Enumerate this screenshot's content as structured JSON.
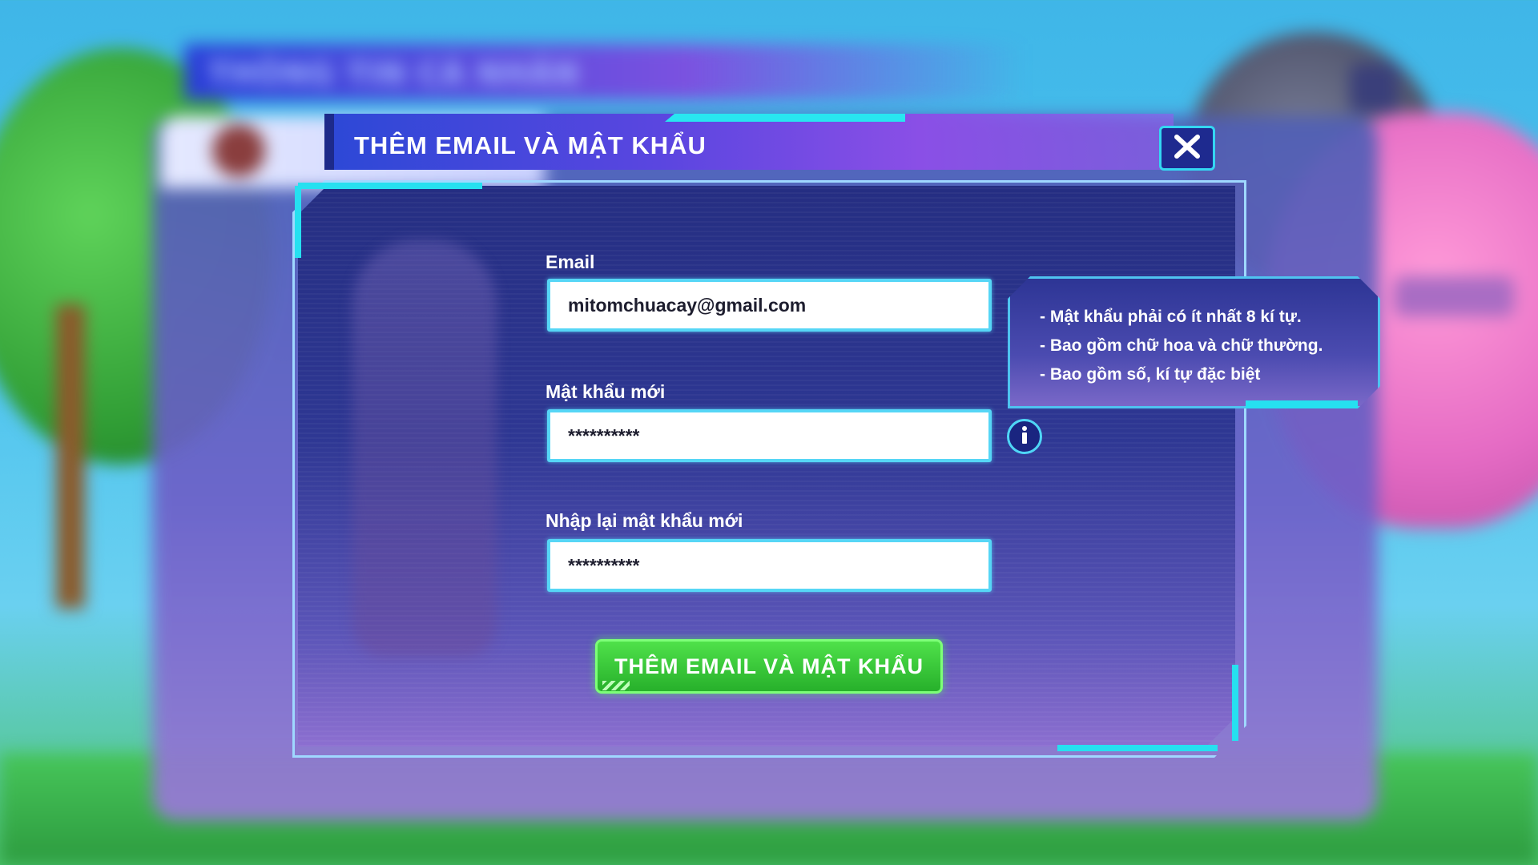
{
  "background": {
    "page_title": "THÔNG TIN CÁ NHÂN"
  },
  "dialog": {
    "title": "THÊM EMAIL VÀ MẬT KHẨU",
    "close_icon": "close-x-icon",
    "fields": {
      "email": {
        "label": "Email",
        "value": "mitomchuacay@gmail.com"
      },
      "new_password": {
        "label": "Mật khẩu mới",
        "value": "**********"
      },
      "confirm_password": {
        "label": "Nhập lại mật khẩu mới",
        "value": "**********"
      }
    },
    "password_rules": [
      "- Mật khẩu phải có ít nhất 8 kí tự.",
      "- Bao gồm chữ hoa và chữ thường.",
      "- Bao gồm số, kí tự đặc biệt"
    ],
    "info_icon": "info-icon",
    "submit_label": "THÊM EMAIL VÀ MẬT KHẨU"
  },
  "colors": {
    "accent_cyan": "#26e0f0",
    "panel_blue": "#252e82",
    "button_green": "#27b02b"
  }
}
